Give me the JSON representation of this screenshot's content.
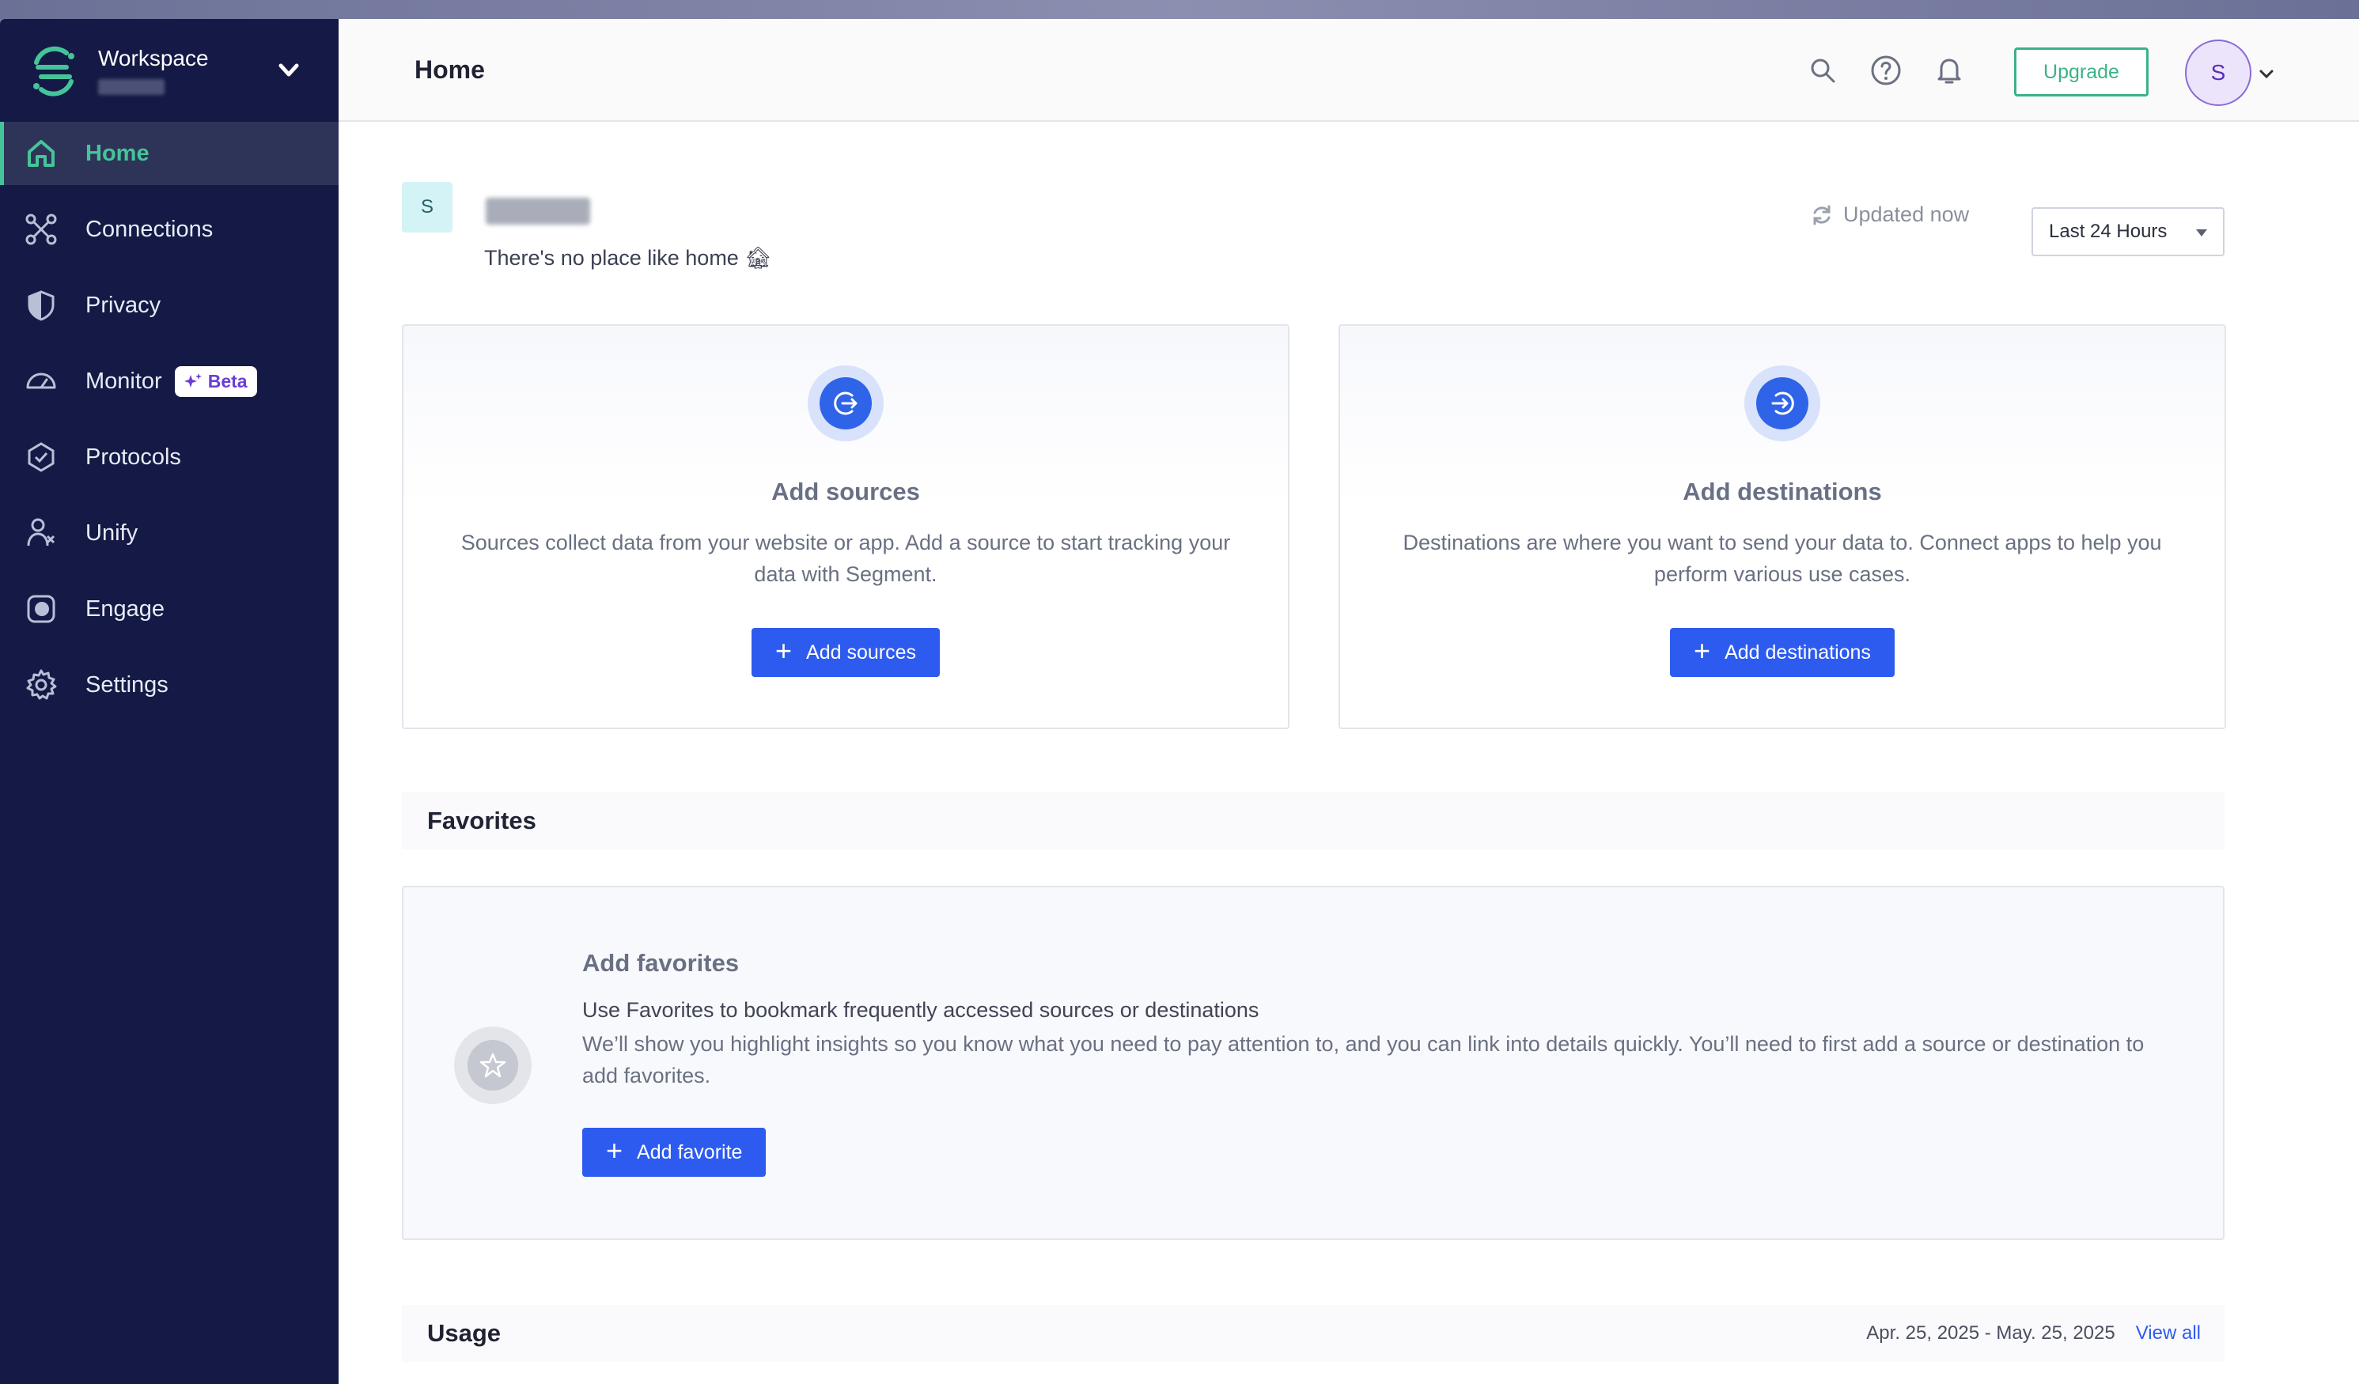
{
  "sidebar": {
    "workspace_label": "Workspace",
    "items": [
      {
        "label": "Home"
      },
      {
        "label": "Connections"
      },
      {
        "label": "Privacy"
      },
      {
        "label": "Monitor",
        "badge": "Beta"
      },
      {
        "label": "Protocols"
      },
      {
        "label": "Unify"
      },
      {
        "label": "Engage"
      },
      {
        "label": "Settings"
      }
    ],
    "active": "Home",
    "accent": "#45c49a",
    "background": "#141a45"
  },
  "header": {
    "title": "Home",
    "upgrade_label": "Upgrade",
    "avatar_initial": "S",
    "icons": [
      "search-icon",
      "help-icon",
      "bell-icon"
    ]
  },
  "greeting": {
    "avatar_initial": "S",
    "message": "There's no place like home 🏚",
    "updated_label": "Updated now",
    "range_label": "Last 24 Hours"
  },
  "cards": {
    "sources": {
      "title": "Add sources",
      "description": "Sources collect data from your website or app. Add a source to start tracking your data with Segment.",
      "button": "Add sources"
    },
    "destinations": {
      "title": "Add destinations",
      "description": "Destinations are where you want to send your data to. Connect apps to help you perform various use cases.",
      "button": "Add destinations"
    }
  },
  "favorites": {
    "section_title": "Favorites",
    "title": "Add favorites",
    "lead": "Use Favorites to bookmark frequently accessed sources or destinations",
    "description": "We’ll show you highlight insights so you know what you need to pay attention to, and you can link into details quickly. You’ll need to first add a source or destination to add favorites.",
    "button": "Add favorite"
  },
  "usage": {
    "section_title": "Usage",
    "date_range": "Apr. 25, 2025 - May. 25, 2025",
    "view_all": "View all"
  }
}
